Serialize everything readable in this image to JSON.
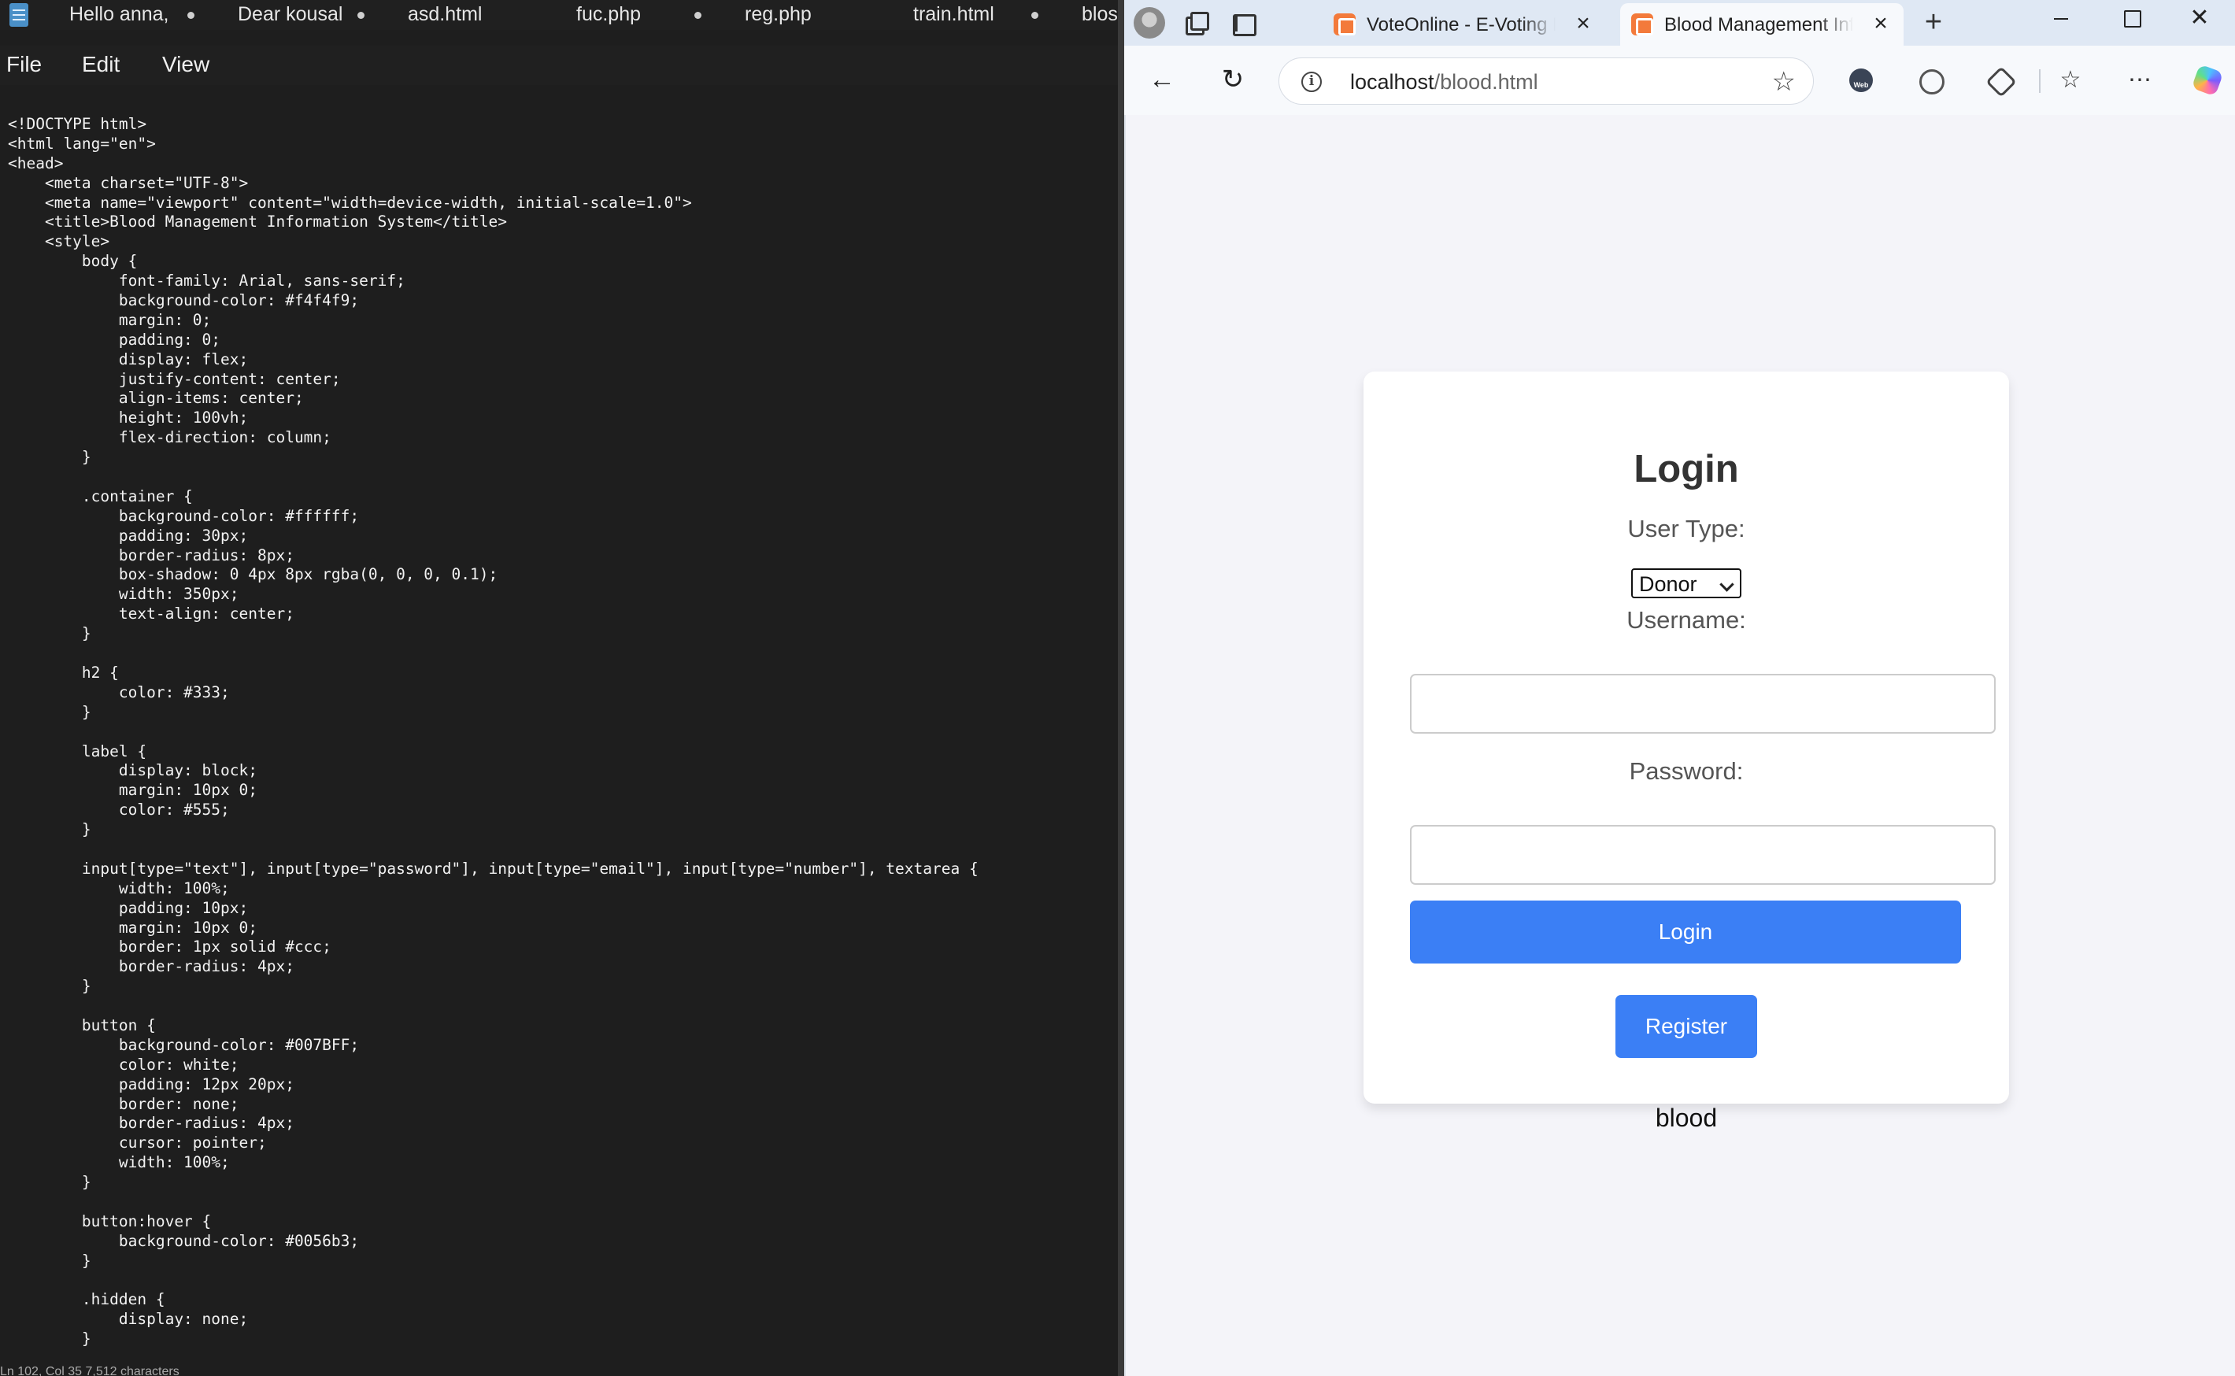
{
  "editor": {
    "tabs": [
      {
        "label": "Hello anna,",
        "dirty": true
      },
      {
        "label": "Dear kousal",
        "dirty": true
      },
      {
        "label": "asd.html",
        "dirty": false
      },
      {
        "label": "fuc.php",
        "dirty": true
      },
      {
        "label": "reg.php",
        "dirty": false
      },
      {
        "label": "train.html",
        "dirty": true
      },
      {
        "label": "blos",
        "dirty": false
      }
    ],
    "menu": [
      "File",
      "Edit",
      "View"
    ],
    "code_lines": [
      "<!DOCTYPE html>",
      "<html lang=\"en\">",
      "<head>",
      "    <meta charset=\"UTF-8\">",
      "    <meta name=\"viewport\" content=\"width=device-width, initial-scale=1.0\">",
      "    <title>Blood Management Information System</title>",
      "    <style>",
      "        body {",
      "            font-family: Arial, sans-serif;",
      "            background-color: #f4f4f9;",
      "            margin: 0;",
      "            padding: 0;",
      "            display: flex;",
      "            justify-content: center;",
      "            align-items: center;",
      "            height: 100vh;",
      "            flex-direction: column;",
      "        }",
      "",
      "        .container {",
      "            background-color: #ffffff;",
      "            padding: 30px;",
      "            border-radius: 8px;",
      "            box-shadow: 0 4px 8px rgba(0, 0, 0, 0.1);",
      "            width: 350px;",
      "            text-align: center;",
      "        }",
      "",
      "        h2 {",
      "            color: #333;",
      "        }",
      "",
      "        label {",
      "            display: block;",
      "            margin: 10px 0;",
      "            color: #555;",
      "        }",
      "",
      "        input[type=\"text\"], input[type=\"password\"], input[type=\"email\"], input[type=\"number\"], textarea {",
      "            width: 100%;",
      "            padding: 10px;",
      "            margin: 10px 0;",
      "            border: 1px solid #ccc;",
      "            border-radius: 4px;",
      "        }",
      "",
      "        button {",
      "            background-color: #007BFF;",
      "            color: white;",
      "            padding: 12px 20px;",
      "            border: none;",
      "            border-radius: 4px;",
      "            cursor: pointer;",
      "            width: 100%;",
      "        }",
      "",
      "        button:hover {",
      "            background-color: #0056b3;",
      "        }",
      "",
      "        .hidden {",
      "            display: none;",
      "        }"
    ],
    "status_text": "Ln 102, Col 35    7,512 characters"
  },
  "browser": {
    "tabs": [
      {
        "title": "VoteOnline - E-Voting P",
        "active": false,
        "icon": "xampp-icon"
      },
      {
        "title": "Blood Management Inf",
        "active": true,
        "icon": "xampp-icon"
      }
    ],
    "address": {
      "host": "localhost",
      "path": "/blood.html"
    },
    "page": {
      "title": "Login",
      "user_type_label": "User Type:",
      "user_type_value": "Donor",
      "username_label": "Username:",
      "username_value": "",
      "password_label": "Password:",
      "password_value": "",
      "login_button": "Login",
      "register_button": "Register",
      "footer_text": "blood"
    },
    "colors": {
      "accent": "#3b7ff5",
      "page_bg": "#f4f4f9"
    }
  }
}
